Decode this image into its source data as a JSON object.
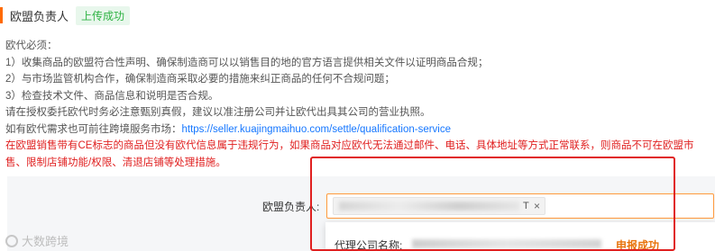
{
  "header": {
    "title": "欧盟负责人",
    "status_tag": "上传成功"
  },
  "info": {
    "line1": "欧代必须：",
    "line2": "1）收集商品的欧盟符合性声明、确保制造商可以以销售目的地的官方语言提供相关文件以证明商品合规；",
    "line3": "2）与市场监管机构合作，确保制造商采取必要的措施来纠正商品的任何不合规问题；",
    "line4": "3）检查技术文件、商品信息和说明是否合规。",
    "line5": "请在授权委托欧代时务必注意甄别真假，建议以准注册公司并让欧代出具其公司的营业执照。",
    "line6_prefix": "如有欧代需求也可前往跨境服务市场：",
    "line6_link": "https://seller.kuajingmaihuo.com/settle/qualification-service",
    "warning_line1": "在欧盟销售带有CE标志的商品但没有欧代信息属于违规行为，如果商品对应欧代无法通过邮件、电话、具体地址等方式正常联系，则商品不可在欧盟市",
    "warning_line2": "售、限制店铺功能/权限、清退店铺等处理措施。"
  },
  "form": {
    "field_label": "欧盟负责人:",
    "selected_chip_suffix": "T",
    "chip_remove": "×"
  },
  "dropdown": {
    "agent_label": "代理公司名称:",
    "success_text": "申报成功"
  },
  "watermark": {
    "logo_text": "大数跨境"
  },
  "colors": {
    "accent": "#ff6a00",
    "success": "#2fb344",
    "link": "#1677ff",
    "warning": "#e02020",
    "declare_success": "#e8740c"
  }
}
